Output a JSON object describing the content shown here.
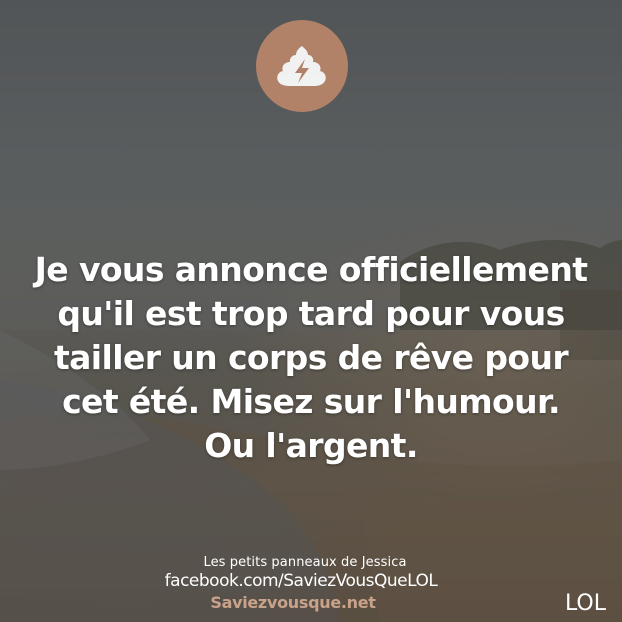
{
  "badge": {
    "icon": "poop-lightning-icon",
    "background_color": "#b9866a"
  },
  "quote": {
    "lines": [
      "Je vous annonce officiellement",
      "qu'il est trop tard pour vous",
      "tailler un corps de rêve pour",
      "cet été. Misez sur l'humour.",
      "Ou l'argent."
    ]
  },
  "credits": {
    "author": "Les petits panneaux de Jessica",
    "facebook": "facebook.com/SaviezVousQueLOL",
    "website": "Saviezvousque.net",
    "website_color": "#c9a28a"
  },
  "category_tag": "LOL"
}
